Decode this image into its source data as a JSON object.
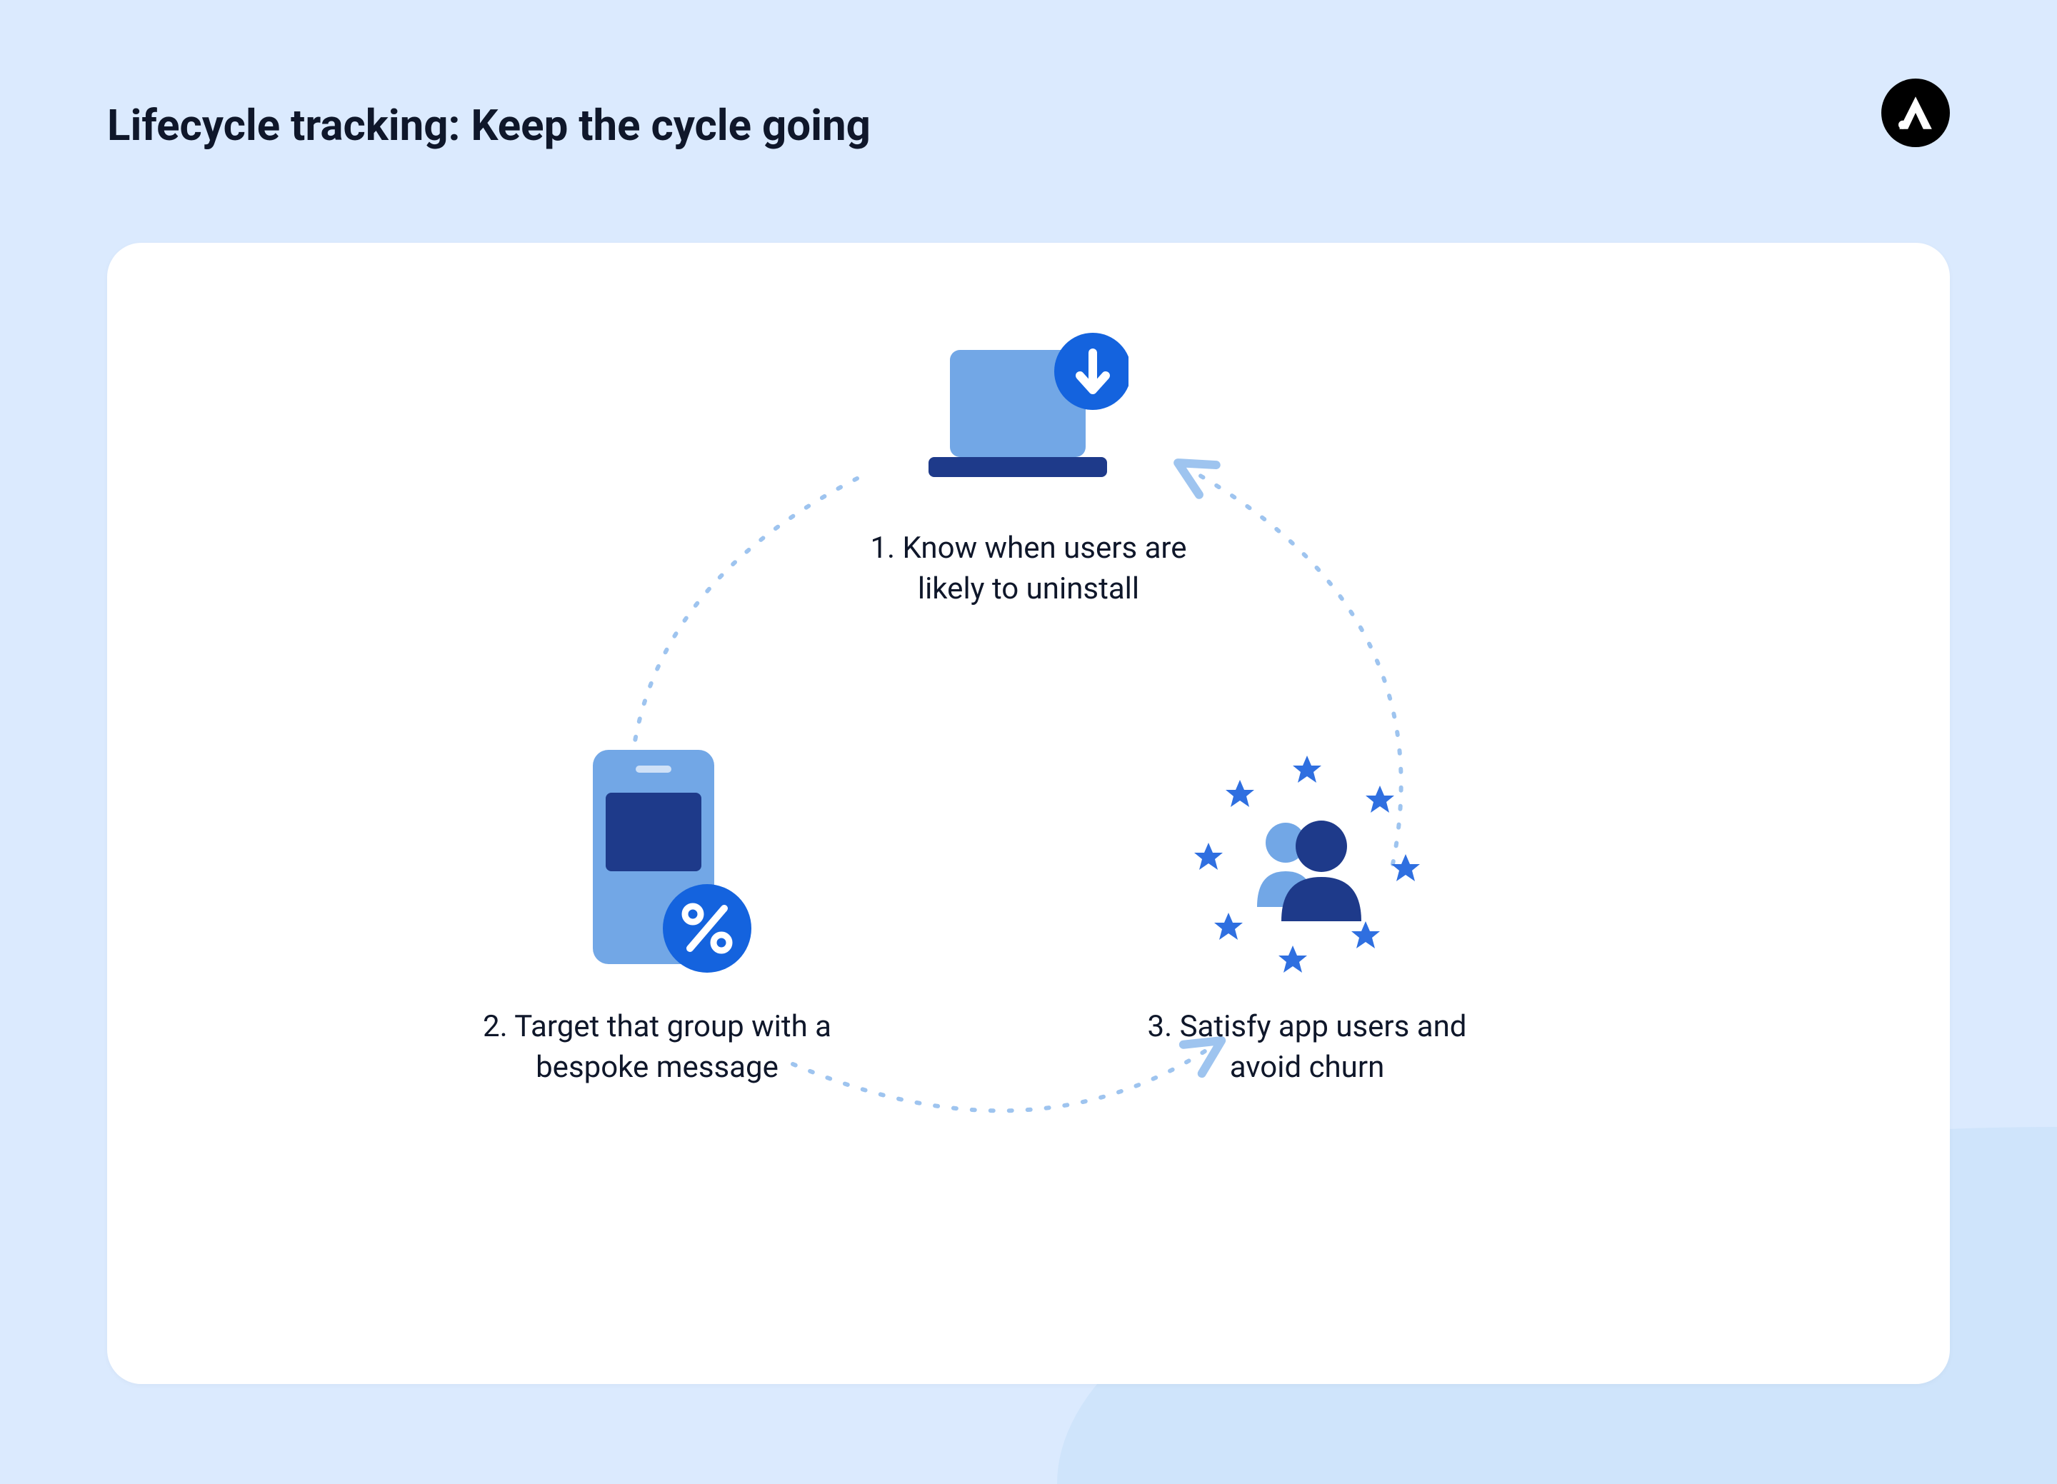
{
  "title": "Lifecycle tracking: Keep the cycle going",
  "logo_name": "brand-logo",
  "steps": {
    "one": {
      "label": "1. Know when users are likely to uninstall"
    },
    "two": {
      "label": "2. Target that group with a bespoke message"
    },
    "three": {
      "label": "3. Satisfy app users and avoid churn"
    }
  },
  "colors": {
    "bg": "#dbeafe",
    "card": "#ffffff",
    "accent_light": "#72a7e6",
    "accent_mid": "#3b82f6",
    "accent_dark": "#1e3a8a",
    "badge": "#1463de",
    "text": "#0f172a"
  }
}
